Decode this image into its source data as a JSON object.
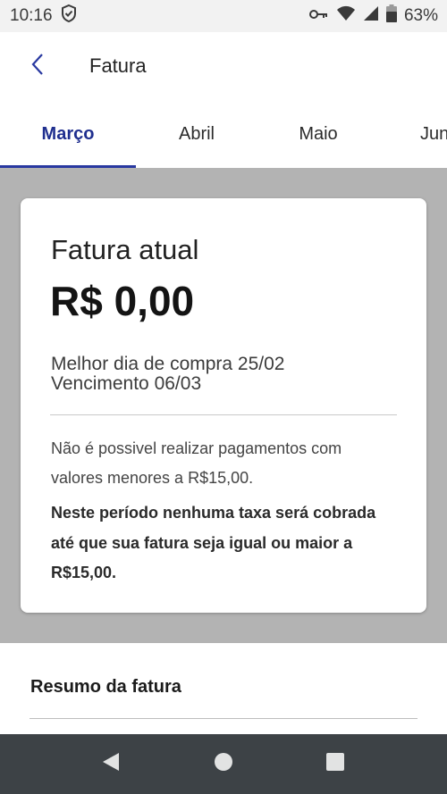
{
  "status_bar": {
    "time": "10:16",
    "battery": "63%",
    "icons": [
      "shield-icon",
      "key-icon",
      "wifi-icon",
      "signal-icon",
      "battery-icon"
    ]
  },
  "app_bar": {
    "title": "Fatura",
    "back_icon": "chevron-left-icon"
  },
  "tabs": [
    {
      "label": "Março",
      "active": true
    },
    {
      "label": "Abril",
      "active": false
    },
    {
      "label": "Maio",
      "active": false
    },
    {
      "label": "Junho",
      "active": false
    }
  ],
  "card": {
    "title": "Fatura atual",
    "amount": "R$ 0,00",
    "best_day": "Melhor dia de compra 25/02",
    "due": "Vencimento 06/03",
    "note_line1": "Não é possivel realizar pagamentos com",
    "note_line2": "valores menores a R$15,00.",
    "bold_line1": "Neste período nenhuma taxa será cobrada",
    "bold_line2": "até que sua fatura seja igual ou maior a",
    "bold_line3": "R$15,00."
  },
  "summary": {
    "title": "Resumo da fatura"
  },
  "colors": {
    "accent": "#1f2f8f",
    "indicator": "#2838a0",
    "gray_background": "#b3b3b3",
    "nav_bar": "#3d4246"
  },
  "nav_bar": {
    "icons": [
      "back-triangle-icon",
      "home-circle-icon",
      "recents-square-icon"
    ]
  }
}
